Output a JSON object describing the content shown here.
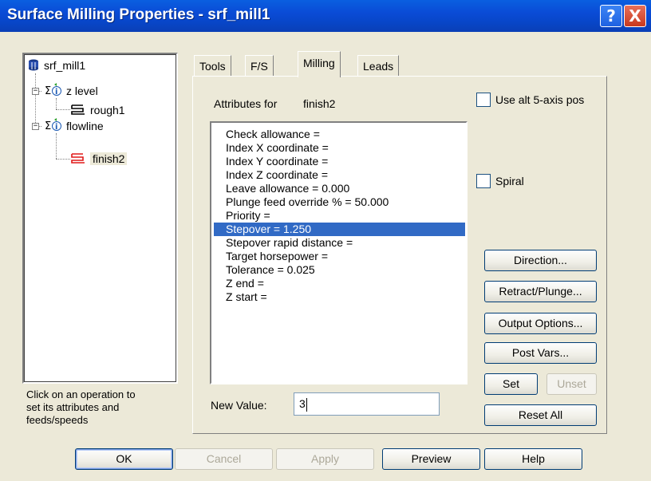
{
  "window": {
    "title": "Surface Milling Properties - srf_mill1",
    "help_btn": "?",
    "close_btn": "X"
  },
  "tree": {
    "root": "srf_mill1",
    "groups": [
      {
        "label": "z level",
        "children": [
          "rough1"
        ]
      },
      {
        "label": "flowline",
        "children": [
          "finish2"
        ]
      }
    ],
    "selected": "finish2"
  },
  "hint": {
    "line1": "Click on an operation to",
    "line2": "set its attributes and",
    "line3": "feeds/speeds"
  },
  "tabs": [
    "Tools",
    "F/S",
    "Milling",
    "Leads"
  ],
  "active_tab": "Milling",
  "milling": {
    "attributes_label": "Attributes for",
    "attributes_target": "finish2",
    "attributes": [
      "Check allowance =",
      "Index X coordinate =",
      "Index Y coordinate =",
      "Index Z coordinate =",
      "Leave allowance = 0.000",
      "Plunge feed override % = 50.000",
      "Priority =",
      "Stepover = 1.250",
      "Stepover rapid distance =",
      "Target horsepower =",
      "Tolerance = 0.025",
      "Z end =",
      "Z start ="
    ],
    "selected_index": 7,
    "use_alt_label": "Use alt 5-axis pos",
    "use_alt_checked": false,
    "spiral_label": "Spiral",
    "spiral_checked": false,
    "new_value_label": "New Value:",
    "new_value": "3",
    "buttons": {
      "direction": "Direction...",
      "retract": "Retract/Plunge...",
      "output": "Output Options...",
      "post_vars": "Post Vars...",
      "set": "Set",
      "unset": "Unset",
      "reset_all": "Reset All"
    }
  },
  "footer": {
    "ok": "OK",
    "cancel": "Cancel",
    "apply": "Apply",
    "preview": "Preview",
    "help": "Help"
  },
  "colors": {
    "titlebar": "#0a4bd6",
    "selection": "#316ac5",
    "dialog_bg": "#ece9d8"
  }
}
